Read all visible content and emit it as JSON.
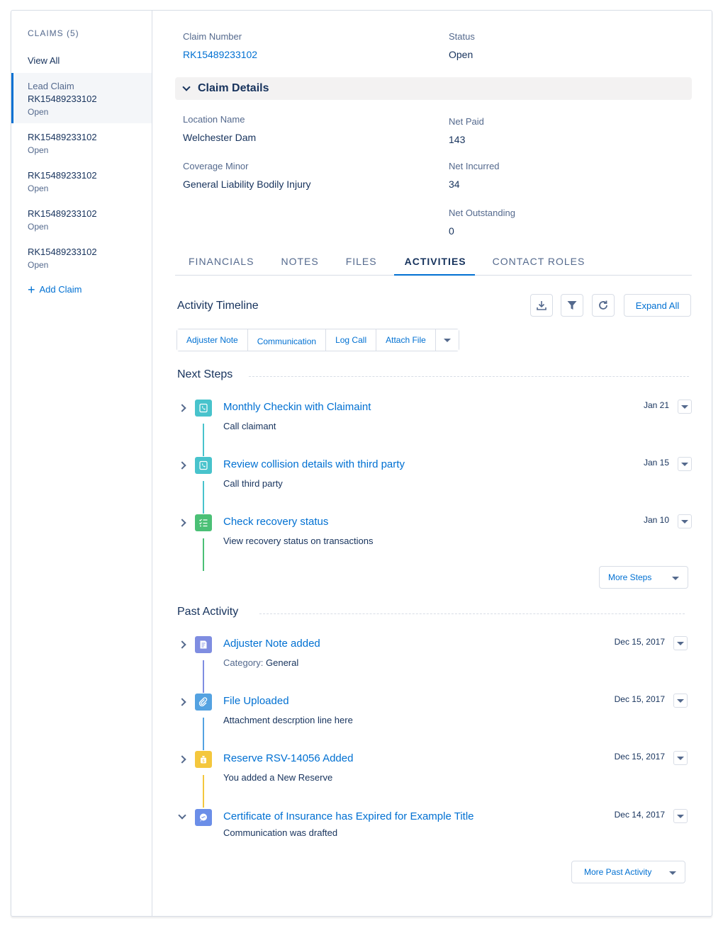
{
  "sidebar": {
    "heading": "CLAIMS (5)",
    "view_all": "View All",
    "lead_label": "Lead Claim",
    "items": [
      {
        "number": "RK15489233102",
        "status": "Open"
      },
      {
        "number": "RK15489233102",
        "status": "Open"
      },
      {
        "number": "RK15489233102",
        "status": "Open"
      },
      {
        "number": "RK15489233102",
        "status": "Open"
      },
      {
        "number": "RK15489233102",
        "status": "Open"
      }
    ],
    "add_claim": "Add Claim"
  },
  "header": {
    "claim_number_label": "Claim Number",
    "claim_number": "RK15489233102",
    "status_label": "Status",
    "status": "Open"
  },
  "claim_details": {
    "title": "Claim Details",
    "location_label": "Location Name",
    "location": "Welchester Dam",
    "coverage_label": "Coverage Minor",
    "coverage": "General Liability Bodily Injury",
    "net_paid_label": "Net Paid",
    "net_paid": "143",
    "net_incurred_label": "Net Incurred",
    "net_incurred": "34",
    "net_outstanding_label": "Net Outstanding",
    "net_outstanding": "0"
  },
  "tabs": [
    "FINANCIALS",
    "NOTES",
    "FILES",
    "ACTIVITIES",
    "CONTACT ROLES"
  ],
  "activity": {
    "title": "Activity Timeline",
    "expand_all": "Expand All",
    "actions": [
      "Adjuster Note",
      "Communication",
      "Log Call",
      "Attach File"
    ],
    "next_steps_title": "Next Steps",
    "next_steps": [
      {
        "name": "Monthly Checkin with Claimaint",
        "desc": "Call claimant",
        "date": "Jan 21",
        "icon": "call-icon",
        "color": "#48c3cc"
      },
      {
        "name": "Review collision details with third party",
        "desc": "Call third party",
        "date": "Jan 15",
        "icon": "call-icon",
        "color": "#48c3cc"
      },
      {
        "name": "Check recovery status",
        "desc": "View recovery status on transactions",
        "date": "Jan 10",
        "icon": "task-icon",
        "color": "#4bc076"
      }
    ],
    "more_steps": "More Steps",
    "past_title": "Past Activity",
    "past": [
      {
        "name": "Adjuster Note added",
        "desc_label": "Category:",
        "desc": "General",
        "date": "Dec 15, 2017",
        "icon": "note-icon",
        "color": "#7f8de1"
      },
      {
        "name": "File Uploaded",
        "desc_label": "",
        "desc": "Attachment descrption line here",
        "date": "Dec 15, 2017",
        "icon": "attachment-icon",
        "color": "#54a2e1"
      },
      {
        "name": "Reserve RSV-14056 Added",
        "desc_label": "",
        "desc": "You added a New Reserve",
        "date": "Dec 15, 2017",
        "icon": "money-bag-icon",
        "color": "#f4c73d"
      },
      {
        "name": "Certificate of Insurance has Expired for Example Title",
        "desc_label": "",
        "desc": "Communication was drafted",
        "date": "Dec 14, 2017",
        "icon": "chat-icon",
        "color": "#6b8ee8"
      }
    ],
    "more_past": "More Past Activity"
  },
  "colors": {
    "brand": "#0070d2",
    "text": "#16325c",
    "muted": "#54698d"
  }
}
